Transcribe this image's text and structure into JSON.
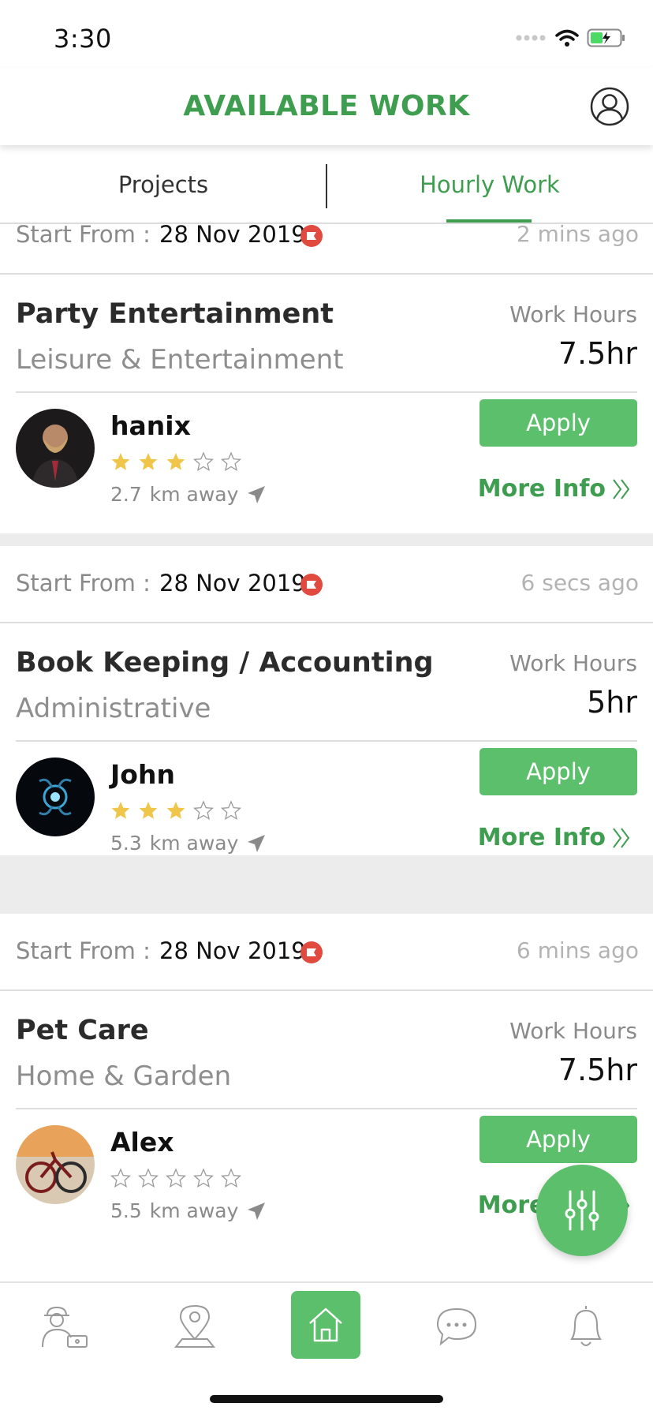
{
  "status_bar": {
    "time": "3:30"
  },
  "header": {
    "title": "AVAILABLE WORK",
    "profile_icon": "user-circle-icon"
  },
  "tabs": [
    {
      "label": "Projects",
      "active": false
    },
    {
      "label": "Hourly Work",
      "active": true
    }
  ],
  "colors": {
    "accent": "#3e9d4f",
    "button": "#5cbf6b",
    "star": "#f0c64a",
    "flag": "#e04a3f"
  },
  "jobs": [
    {
      "start_label": "Start From :",
      "start_day": "28",
      "start_month_year": "Nov 2019",
      "posted": "2 mins ago",
      "title": "Party Entertainment",
      "category": "Leisure & Entertainment",
      "hours_label": "Work Hours",
      "hours": "7.5hr",
      "user": "hanix",
      "rating": 3,
      "distance_value": "2.7",
      "distance_unit": "km away",
      "apply_label": "Apply",
      "more_info_label": "More Info"
    },
    {
      "start_label": "Start From :",
      "start_day": "28",
      "start_month_year": "Nov 2019",
      "posted": "6 secs ago",
      "title": "Book Keeping / Accounting",
      "category": "Administrative",
      "hours_label": "Work Hours",
      "hours": "5hr",
      "user": "John",
      "rating": 3,
      "distance_value": "5.3",
      "distance_unit": "km away",
      "apply_label": "Apply",
      "more_info_label": "More Info"
    },
    {
      "start_label": "Start From :",
      "start_day": "28",
      "start_month_year": "Nov 2019",
      "posted": "6 mins ago",
      "title": "Pet Care",
      "category": "Home & Garden",
      "hours_label": "Work Hours",
      "hours": "7.5hr",
      "user": "Alex",
      "rating": 0,
      "distance_value": "5.5",
      "distance_unit": "km away",
      "apply_label": "Apply",
      "more_info_label": "More Info"
    }
  ],
  "fab": {
    "icon": "filter-sliders-icon"
  },
  "bottom_nav": [
    {
      "icon": "worker-icon",
      "active": false
    },
    {
      "icon": "map-pin-icon",
      "active": false
    },
    {
      "icon": "home-icon",
      "active": true
    },
    {
      "icon": "chat-icon",
      "active": false
    },
    {
      "icon": "bell-icon",
      "active": false
    }
  ]
}
